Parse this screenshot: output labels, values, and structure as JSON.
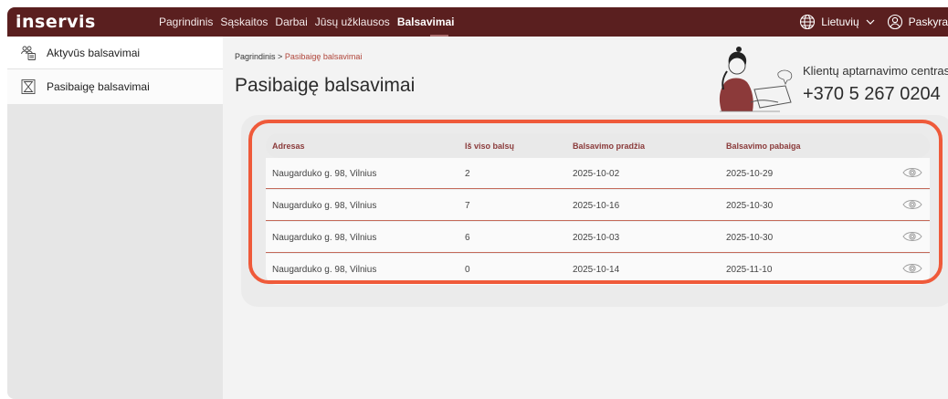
{
  "brand": {
    "logo": "inservis"
  },
  "nav": {
    "items": [
      "Pagrindinis",
      "Sąskaitos",
      "Darbai",
      "Jūsų užklausos",
      "Balsavimai"
    ],
    "active": "Balsavimai"
  },
  "topbar": {
    "language": "Lietuvių",
    "account": "Paskyra"
  },
  "sidebar": {
    "items": [
      {
        "label": "Aktyvūs balsavimai",
        "icon": "people-icon"
      },
      {
        "label": "Pasibaigę balsavimai",
        "icon": "hourglass-icon"
      }
    ]
  },
  "breadcrumb": {
    "home": "Pagrindinis",
    "separator": ">",
    "current": "Pasibaigę balsavimai"
  },
  "page": {
    "title": "Pasibaigę balsavimai"
  },
  "support": {
    "label": "Klientų aptarnavimo centras",
    "phone": "+370 5 267 0204"
  },
  "table": {
    "headers": {
      "address": "Adresas",
      "total": "Iš viso balsų",
      "start": "Balsavimo pradžia",
      "end": "Balsavimo pabaiga"
    },
    "rows": [
      {
        "address": "Naugarduko g. 98, Vilnius",
        "total": "2",
        "start": "2025-10-02",
        "end": "2025-10-29"
      },
      {
        "address": "Naugarduko g. 98, Vilnius",
        "total": "7",
        "start": "2025-10-16",
        "end": "2025-10-30"
      },
      {
        "address": "Naugarduko g. 98, Vilnius",
        "total": "6",
        "start": "2025-10-03",
        "end": "2025-10-30"
      },
      {
        "address": "Naugarduko g. 98, Vilnius",
        "total": "0",
        "start": "2025-10-14",
        "end": "2025-11-10"
      }
    ]
  },
  "colors": {
    "topbar": "#5a1f1f",
    "accent": "#b0453a",
    "highlight": "#ef5a3a",
    "header_text": "#8b3b3b"
  }
}
